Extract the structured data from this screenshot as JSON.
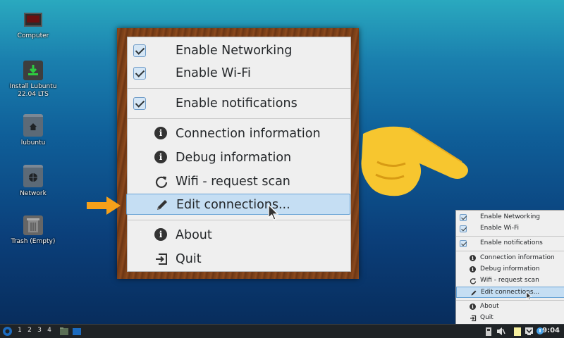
{
  "desktop": {
    "icons": [
      {
        "label": "Computer",
        "icon": "computer-icon"
      },
      {
        "label": "Install Lubuntu 22.04 LTS",
        "icon": "installer-icon"
      },
      {
        "label": "lubuntu",
        "icon": "home-folder-icon"
      },
      {
        "label": "Network",
        "icon": "network-folder-icon"
      },
      {
        "label": "Trash (Empty)",
        "icon": "trash-icon"
      }
    ]
  },
  "menu": {
    "items": [
      {
        "label": "Enable Networking",
        "checked": true
      },
      {
        "label": "Enable Wi-Fi",
        "checked": true
      },
      {
        "label": "Enable notifications",
        "checked": true
      },
      {
        "label": "Connection information",
        "icon": "info-icon"
      },
      {
        "label": "Debug information",
        "icon": "info-icon"
      },
      {
        "label": "Wifi - request scan",
        "icon": "refresh-icon"
      },
      {
        "label": "Edit connections...",
        "icon": "pencil-icon",
        "highlighted": true
      },
      {
        "label": "About",
        "icon": "info-icon"
      },
      {
        "label": "Quit",
        "icon": "quit-icon"
      }
    ]
  },
  "taskbar": {
    "workspaces": [
      "1",
      "2",
      "3",
      "4"
    ],
    "clock": "9:04"
  },
  "colors": {
    "highlight": "#c5def3",
    "highlight_border": "#6aa4d6",
    "arrow": "#f5a01a",
    "frame": "#7a3f18"
  }
}
